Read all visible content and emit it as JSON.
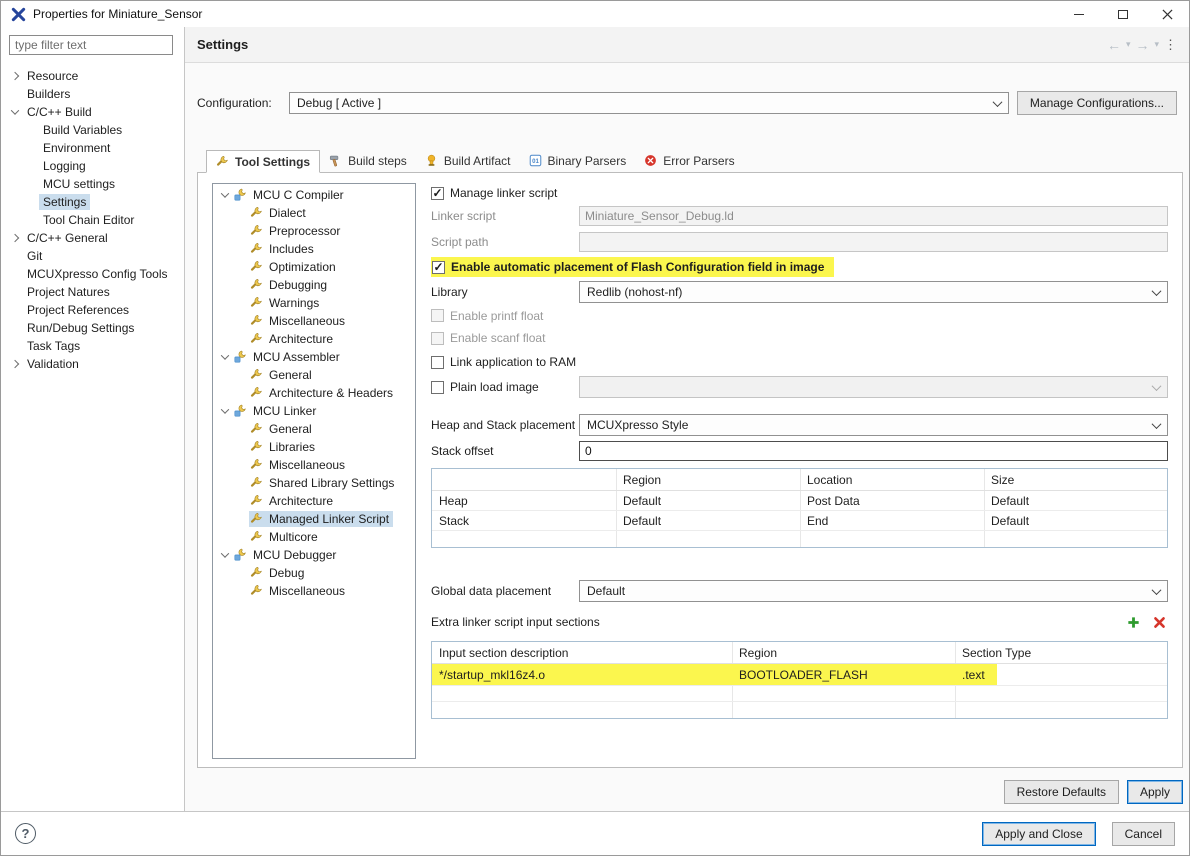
{
  "window": {
    "title": "Properties for Miniature_Sensor"
  },
  "sidebar": {
    "filter": {
      "placeholder": "type filter text"
    },
    "items": [
      {
        "label": "Resource",
        "arrow": "collapsed",
        "depth": 0
      },
      {
        "label": "Builders",
        "arrow": "none",
        "depth": 0
      },
      {
        "label": "C/C++ Build",
        "arrow": "expanded",
        "depth": 0
      },
      {
        "label": "Build Variables",
        "arrow": "none",
        "depth": 1
      },
      {
        "label": "Environment",
        "arrow": "none",
        "depth": 1
      },
      {
        "label": "Logging",
        "arrow": "none",
        "depth": 1
      },
      {
        "label": "MCU settings",
        "arrow": "none",
        "depth": 1
      },
      {
        "label": "Settings",
        "arrow": "none",
        "depth": 1,
        "selected": true
      },
      {
        "label": "Tool Chain Editor",
        "arrow": "none",
        "depth": 1
      },
      {
        "label": "C/C++ General",
        "arrow": "collapsed",
        "depth": 0
      },
      {
        "label": "Git",
        "arrow": "none",
        "depth": 0
      },
      {
        "label": "MCUXpresso Config Tools",
        "arrow": "none",
        "depth": 0
      },
      {
        "label": "Project Natures",
        "arrow": "none",
        "depth": 0
      },
      {
        "label": "Project References",
        "arrow": "none",
        "depth": 0
      },
      {
        "label": "Run/Debug Settings",
        "arrow": "none",
        "depth": 0
      },
      {
        "label": "Task Tags",
        "arrow": "none",
        "depth": 0
      },
      {
        "label": "Validation",
        "arrow": "collapsed",
        "depth": 0
      }
    ]
  },
  "header": {
    "title": "Settings",
    "nav_icons": [
      "back-icon",
      "back-menu-icon",
      "forward-icon",
      "forward-menu-icon",
      "view-menu-icon"
    ]
  },
  "config": {
    "label": "Configuration:",
    "value": "Debug  [ Active ]",
    "manage_button": "Manage Configurations..."
  },
  "tabs": [
    {
      "label": "Tool Settings",
      "icon": "wrench-icon",
      "active": true
    },
    {
      "label": "Build steps",
      "icon": "hammer-icon",
      "active": false
    },
    {
      "label": "Build Artifact",
      "icon": "artifact-icon",
      "active": false
    },
    {
      "label": "Binary Parsers",
      "icon": "binary-icon",
      "active": false
    },
    {
      "label": "Error Parsers",
      "icon": "error-icon",
      "active": false
    }
  ],
  "tool_tree": [
    {
      "label": "MCU C Compiler",
      "type": "category"
    },
    {
      "label": "Dialect",
      "type": "leaf"
    },
    {
      "label": "Preprocessor",
      "type": "leaf"
    },
    {
      "label": "Includes",
      "type": "leaf"
    },
    {
      "label": "Optimization",
      "type": "leaf"
    },
    {
      "label": "Debugging",
      "type": "leaf"
    },
    {
      "label": "Warnings",
      "type": "leaf"
    },
    {
      "label": "Miscellaneous",
      "type": "leaf"
    },
    {
      "label": "Architecture",
      "type": "leaf"
    },
    {
      "label": "MCU Assembler",
      "type": "category"
    },
    {
      "label": "General",
      "type": "leaf"
    },
    {
      "label": "Architecture & Headers",
      "type": "leaf"
    },
    {
      "label": "MCU Linker",
      "type": "category"
    },
    {
      "label": "General",
      "type": "leaf"
    },
    {
      "label": "Libraries",
      "type": "leaf"
    },
    {
      "label": "Miscellaneous",
      "type": "leaf"
    },
    {
      "label": "Shared Library Settings",
      "type": "leaf"
    },
    {
      "label": "Architecture",
      "type": "leaf"
    },
    {
      "label": "Managed Linker Script",
      "type": "leaf",
      "selected": true
    },
    {
      "label": "Multicore",
      "type": "leaf"
    },
    {
      "label": "MCU Debugger",
      "type": "category"
    },
    {
      "label": "Debug",
      "type": "leaf"
    },
    {
      "label": "Miscellaneous",
      "type": "leaf"
    }
  ],
  "form": {
    "manage_linker_script": {
      "label": "Manage linker script",
      "checked": true
    },
    "linker_script": {
      "label": "Linker script",
      "value": "Miniature_Sensor_Debug.ld"
    },
    "script_path": {
      "label": "Script path",
      "value": ""
    },
    "flash_config": {
      "label": "Enable automatic placement of Flash Configuration field in image",
      "checked": true,
      "highlighted": true
    },
    "library": {
      "label": "Library",
      "value": "Redlib (nohost-nf)"
    },
    "printf_float": {
      "label": "Enable printf float",
      "checked": false,
      "disabled": true
    },
    "scanf_float": {
      "label": "Enable scanf float",
      "checked": false,
      "disabled": true
    },
    "link_app_ram": {
      "label": "Link application to RAM",
      "checked": false
    },
    "plain_load": {
      "label": "Plain load image",
      "checked": false
    },
    "heap_stack": {
      "label": "Heap and Stack placement",
      "value": "MCUXpresso Style"
    },
    "stack_offset": {
      "label": "Stack offset",
      "value": "0"
    },
    "global_data": {
      "label": "Global data placement",
      "value": "Default"
    }
  },
  "heap_table": {
    "columns": [
      "",
      "Region",
      "Location",
      "Size"
    ],
    "rows": [
      {
        "name": "Heap",
        "region": "Default",
        "location": "Post Data",
        "size": "Default"
      },
      {
        "name": "Stack",
        "region": "Default",
        "location": "End",
        "size": "Default"
      }
    ]
  },
  "extra_sections": {
    "title": "Extra linker script input sections",
    "columns": [
      "Input section description",
      "Region",
      "Section Type"
    ],
    "rows": [
      {
        "description": "*/startup_mkl16z4.o",
        "region": "BOOTLOADER_FLASH",
        "section_type": ".text",
        "highlighted": true
      }
    ]
  },
  "tab_buttons": {
    "restore_defaults": "Restore Defaults",
    "apply": "Apply"
  },
  "footer": {
    "help": "?",
    "apply_and_close": "Apply and Close",
    "cancel": "Cancel"
  },
  "colors": {
    "highlight": "#fbf64e",
    "accent": "#0067c0",
    "add_green": "#2e9b2e",
    "remove_red": "#d6352b",
    "selection": "#cadded"
  }
}
